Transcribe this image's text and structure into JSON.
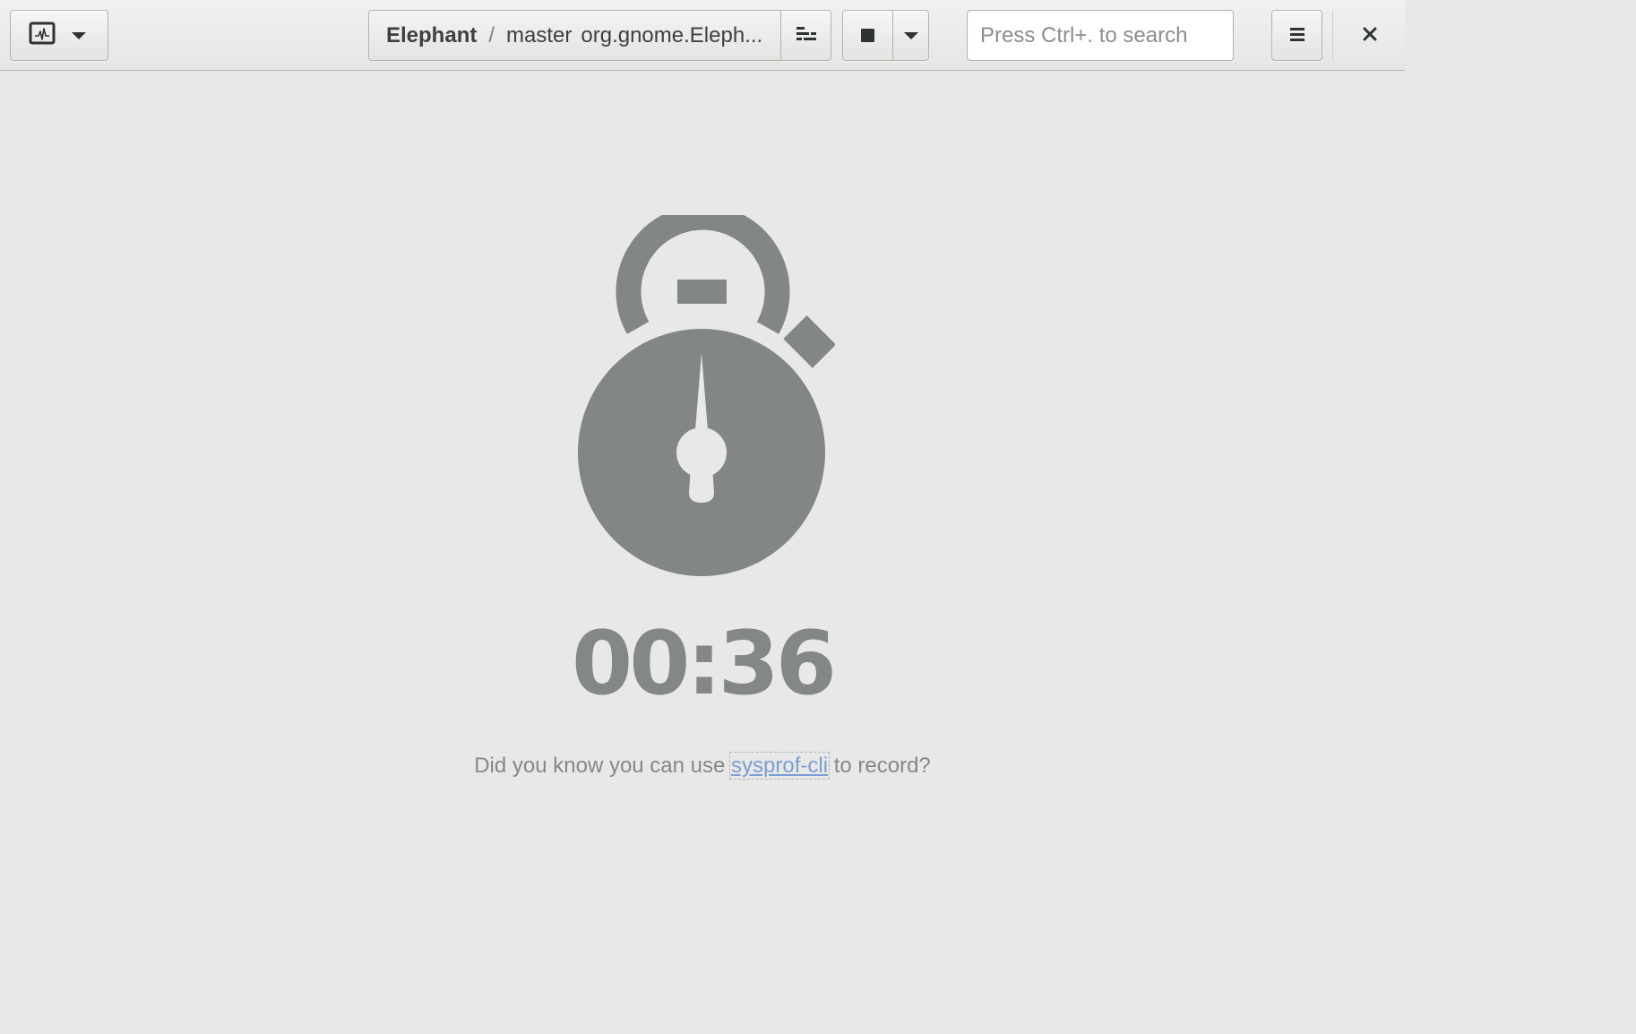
{
  "header": {
    "profiler_menu_icon": "activity-monitor-icon",
    "title": {
      "project": "Elephant",
      "separator": "/",
      "branch": "master",
      "app_id": "org.gnome.Eleph..."
    },
    "process_button_icon": "process-list-icon",
    "record_button_icon": "stop-icon",
    "search": {
      "placeholder": "Press Ctrl+. to search",
      "value": ""
    },
    "menu_icon": "hamburger-menu-icon",
    "close_icon": "close-icon"
  },
  "recording": {
    "elapsed": "00:36",
    "tip_prefix": "Did you know you can use ",
    "tip_link": "sysprof-cli",
    "tip_suffix": " to record?"
  },
  "colors": {
    "icon_gray": "#828687",
    "timer_gray": "#848787",
    "link_blue": "#7a9fd3",
    "background": "#e8e8e7"
  }
}
